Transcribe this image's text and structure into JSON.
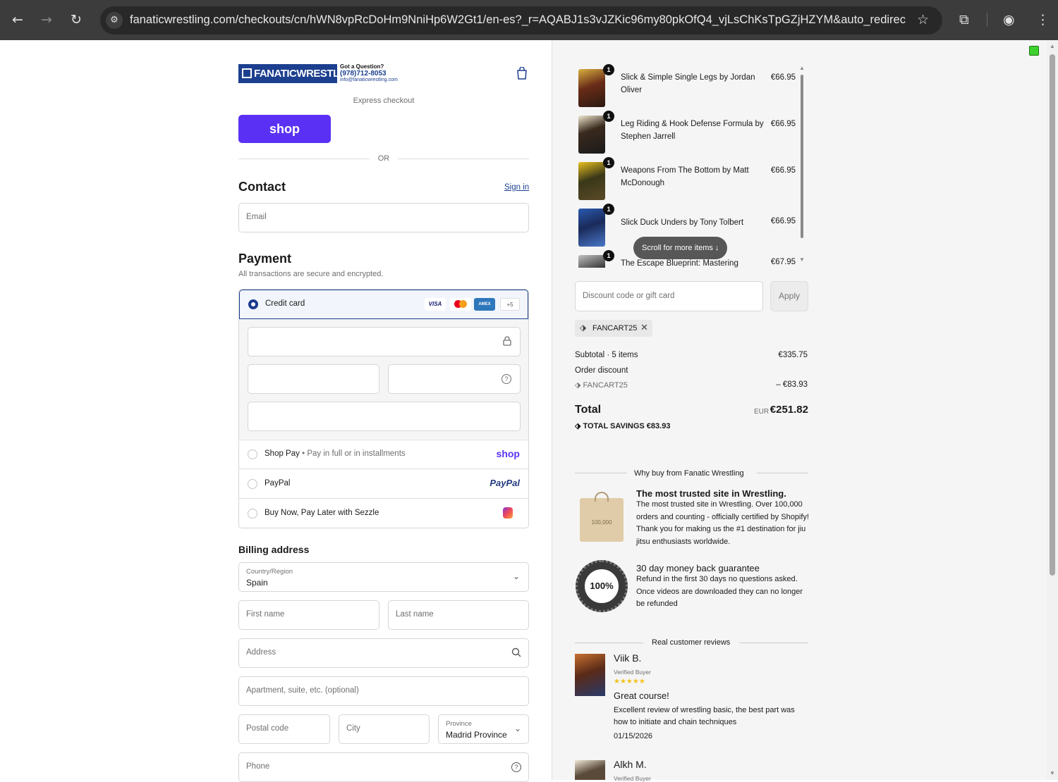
{
  "browser": {
    "url": "fanaticwrestling.com/checkouts/cn/hWN8vpRcDoHm9NniHp6W2Gt1/en-es?_r=AQABJ1s3vJZKic96my80pkOfQ4_vjLsChKsTpGZjHZYM&auto_redirect=f..."
  },
  "brand": {
    "logo_text": "FANATICWRESTLING",
    "question": "Got a Question?",
    "phone": "(978)712-8053",
    "email": "info@fanaticwrestling.com"
  },
  "express": {
    "label": "Express checkout",
    "shop_label": "shop",
    "or": "OR"
  },
  "contact": {
    "title": "Contact",
    "sign_in": "Sign in",
    "email_placeholder": "Email"
  },
  "payment": {
    "title": "Payment",
    "subtitle": "All transactions are secure and encrypted.",
    "credit_card": "Credit card",
    "more_cards": "+5",
    "card_brands": [
      "VISA",
      "",
      "AMEX"
    ],
    "shop_pay": "Shop Pay",
    "shop_pay_sub": "Pay in full or in installments",
    "shop_logo": "shop",
    "paypal": "PayPal",
    "paypal_logo": "PayPal",
    "sezzle": "Buy Now, Pay Later with Sezzle"
  },
  "billing": {
    "title": "Billing address",
    "country_label": "Country/Region",
    "country": "Spain",
    "first_name": "First name",
    "last_name": "Last name",
    "address": "Address",
    "apartment": "Apartment, suite, etc. (optional)",
    "postal": "Postal code",
    "city": "City",
    "province_label": "Province",
    "province": "Madrid Province",
    "phone": "Phone"
  },
  "cart": {
    "items": [
      {
        "name": "Slick & Simple Single Legs by Jordan Oliver",
        "price": "€66.95",
        "qty": "1"
      },
      {
        "name": "Leg Riding & Hook Defense Formula by Stephen Jarrell",
        "price": "€66.95",
        "qty": "1"
      },
      {
        "name": "Weapons From The Bottom by Matt McDonough",
        "price": "€66.95",
        "qty": "1"
      },
      {
        "name": "Slick Duck Unders by Tony Tolbert",
        "price": "€66.95",
        "qty": "1"
      },
      {
        "name": "The Escape Blueprint: Mastering",
        "price": "€67.95",
        "qty": "1"
      }
    ],
    "scroll_more": "Scroll for more items"
  },
  "discount": {
    "placeholder": "Discount code or gift card",
    "apply": "Apply",
    "code": "FANCART25"
  },
  "summary": {
    "subtotal_label": "Subtotal · 5 items",
    "subtotal": "€335.75",
    "order_discount": "Order discount",
    "discount_code": "FANCART25",
    "discount_amount": "– €83.93",
    "total_label": "Total",
    "currency": "EUR",
    "total": "€251.82",
    "savings_label": "TOTAL SAVINGS",
    "savings": "€83.93"
  },
  "why": {
    "title": "Why buy from Fanatic Wrestling",
    "trust_title": "The most trusted site in Wrestling.",
    "trust_body": "The most trusted site in Wrestling. Over 100,000 orders and counting - officially certified by Shopify! Thank you for making us the #1 destination for jiu jitsu enthusiasts worldwide.",
    "bag_text": "100,000",
    "guarantee_title": "30 day money back guarantee",
    "guarantee_body": "Refund in the first 30 days no questions asked. Once videos are downloaded they can no longer be refunded",
    "seal_text": "100%"
  },
  "reviews": {
    "title": "Real customer reviews",
    "items": [
      {
        "name": "Viik B.",
        "verified": "Verified Buyer",
        "stars": "★★★★★",
        "headline": "Great course!",
        "body": "Excellent review of wrestling basic, the best part was how to initiate and chain techniques",
        "date": "01/15/2026"
      },
      {
        "name": "Alkh M.",
        "verified": "Verified Buyer"
      }
    ]
  }
}
